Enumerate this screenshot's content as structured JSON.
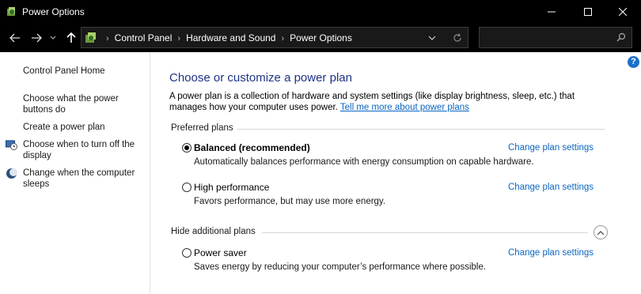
{
  "window": {
    "title": "Power Options",
    "icons": {
      "app": "power-options-icon",
      "minimize": "minimize-icon",
      "maximize": "maximize-icon",
      "close": "close-icon"
    }
  },
  "navbar": {
    "breadcrumbs": [
      "Control Panel",
      "Hardware and Sound",
      "Power Options"
    ],
    "search_placeholder": "",
    "icons": {
      "back": "back-arrow-icon",
      "forward": "forward-arrow-icon",
      "recent": "chevron-down-icon",
      "up": "up-arrow-icon",
      "dropdown": "chevron-down-icon",
      "refresh": "refresh-icon",
      "search": "search-icon"
    }
  },
  "sidebar": {
    "home": "Control Panel Home",
    "links": [
      {
        "label": "Choose what the power buttons do"
      },
      {
        "label": "Create a power plan"
      },
      {
        "label": "Choose when to turn off the display",
        "icon": "display-clock-icon"
      },
      {
        "label": "Change when the computer sleeps",
        "icon": "moon-sleep-icon"
      }
    ]
  },
  "main": {
    "heading": "Choose or customize a power plan",
    "intro": "A power plan is a collection of hardware and system settings (like display brightness, sleep, etc.) that manages how your computer uses power.",
    "intro_link": "Tell me more about power plans",
    "preferred_label": "Preferred plans",
    "hidden_label": "Hide additional plans",
    "change_link": "Change plan settings",
    "help_icon": "help-icon",
    "plans": [
      {
        "name": "Balanced (recommended)",
        "description": "Automatically balances performance with energy consumption on capable hardware.",
        "selected": true
      },
      {
        "name": "High performance",
        "description": "Favors performance, but may use more energy.",
        "selected": false
      },
      {
        "name": "Power saver",
        "description": "Saves energy by reducing your computer’s performance where possible.",
        "selected": false
      }
    ]
  },
  "colors": {
    "accent_link": "#0a66c2",
    "heading": "#1e3287",
    "titlebar": "#000000",
    "help": "#1c6fc9"
  }
}
